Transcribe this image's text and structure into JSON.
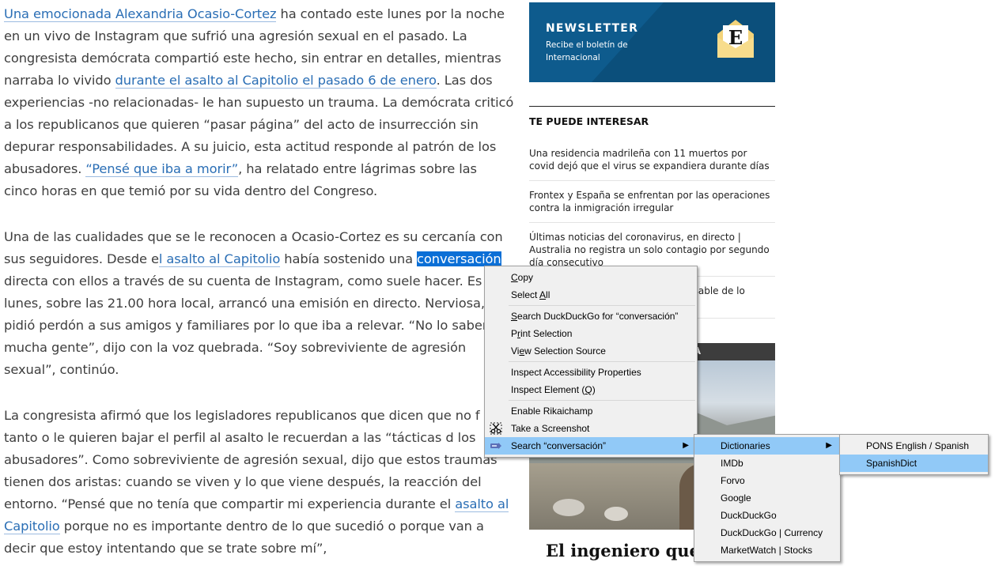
{
  "article": {
    "p1": {
      "link1": "Una emocionada Alexandria Ocasio-Cortez",
      "t1": " ha contado este lunes por la noche en un vivo de Instagram que sufrió una agresión sexual en el pasado. La congresista demócrata compartió este hecho, sin entrar en detalles, mientras narraba lo vivido ",
      "link2": "durante el asalto al Capitolio el pasado 6 de enero",
      "t2": ". Las dos experiencias -no relacionadas- le han supuesto un trauma. La demócrata criticó a los republicanos que quieren “pasar página” del acto de insurrección sin depurar responsabilidades. A su juicio, esta actitud responde al patrón de los abusadores. ",
      "link3": "“Pensé que iba a morir”",
      "t3": ", ha relatado entre lágrimas sobre las cinco horas en que temió por su vida dentro del Congreso."
    },
    "p2": {
      "t1": "Una de las cualidades que se le reconocen a Ocasio-Cortez es su cercanía con sus seguidores. Desde e",
      "link1": "l asalto al Capitolio",
      "t2": " había sostenido una ",
      "selected": "conversación",
      "t3": " directa con ellos a través de su cuenta de Instagram, como suele hacer. Es lunes, sobre las 21.00 hora local, arrancó una emisión en directo. Nerviosa, pidió perdón a sus amigos y familiares por lo que iba a relevar. “No lo saben mucha gente”, dijo con la voz quebrada. “Soy sobreviviente de agresión sexual”, continúo."
    },
    "p3": {
      "t1": "La congresista afirmó que los legisladores republicanos que dicen que no f para tanto o le quieren bajar el perfil al asalto le recuerdan a las “tácticas d los abusadores”. Como sobreviviente de agresión sexual, dijo que estos traumas tienen dos aristas: cuando se viven y lo que viene después, la reacción del entorno. “Pensé que no tenía que compartir mi experiencia durante el ",
      "link1": "asalto al Capitolio",
      "t2": " porque no es importante dentro de lo que sucedió o porque van a decir que estoy intentando que se trate sobre mí”,"
    }
  },
  "sidebar": {
    "newsletter": {
      "title": "NEWSLETTER",
      "subtitle": "Recibe el boletín de Internacional",
      "logo_letter": "E",
      "bg_color": "#0e5b8d"
    },
    "recommend_heading": "TE PUEDE INTERESAR",
    "recommendations": [
      "Una residencia madrileña con 11 muertos por covid dejó que el virus se expandiera durante días",
      "Frontex y España se enfrentan por las operaciones contra la inmigración irregular",
      "Últimas noticias del coronavirus, en directo | Australia no registra un solo contagio por segundo día consecutivo",
      "nsable de lo"
    ],
    "photo_section_label": "TA",
    "photo_title": "El ingeniero que ayud"
  },
  "context_menu": {
    "items": [
      {
        "label": "Copy",
        "accel": "C"
      },
      {
        "label": "Select All",
        "accel": "A"
      },
      {
        "separator": true
      },
      {
        "label": "Search DuckDuckGo for “conversación”",
        "accel": "S"
      },
      {
        "label": "Print Selection",
        "accel": "r"
      },
      {
        "label": "View Selection Source",
        "accel": "e"
      },
      {
        "separator": true
      },
      {
        "label": "Inspect Accessibility Properties"
      },
      {
        "label": "Inspect Element (Q)",
        "accel": "Q"
      },
      {
        "separator": true
      },
      {
        "label": "Enable Rikaichamp"
      },
      {
        "label": "Take a Screenshot",
        "icon": "scissors-screenshot-icon"
      },
      {
        "label": "Search “conversación”",
        "icon": "search-extension-icon",
        "submenu": true,
        "highlighted": true
      }
    ],
    "search_submenu": [
      {
        "label": "Dictionaries",
        "submenu": true,
        "highlighted": true
      },
      {
        "label": "IMDb"
      },
      {
        "label": "Forvo"
      },
      {
        "label": "Google"
      },
      {
        "label": "DuckDuckGo"
      },
      {
        "label": "DuckDuckGo | Currency"
      },
      {
        "label": "MarketWatch | Stocks"
      }
    ],
    "dictionaries_submenu": [
      {
        "label": "PONS English / Spanish"
      },
      {
        "label": "SpanishDict",
        "highlighted": true
      }
    ],
    "highlight_color": "#91c9f7",
    "selection_color": "#0b6fd6"
  }
}
